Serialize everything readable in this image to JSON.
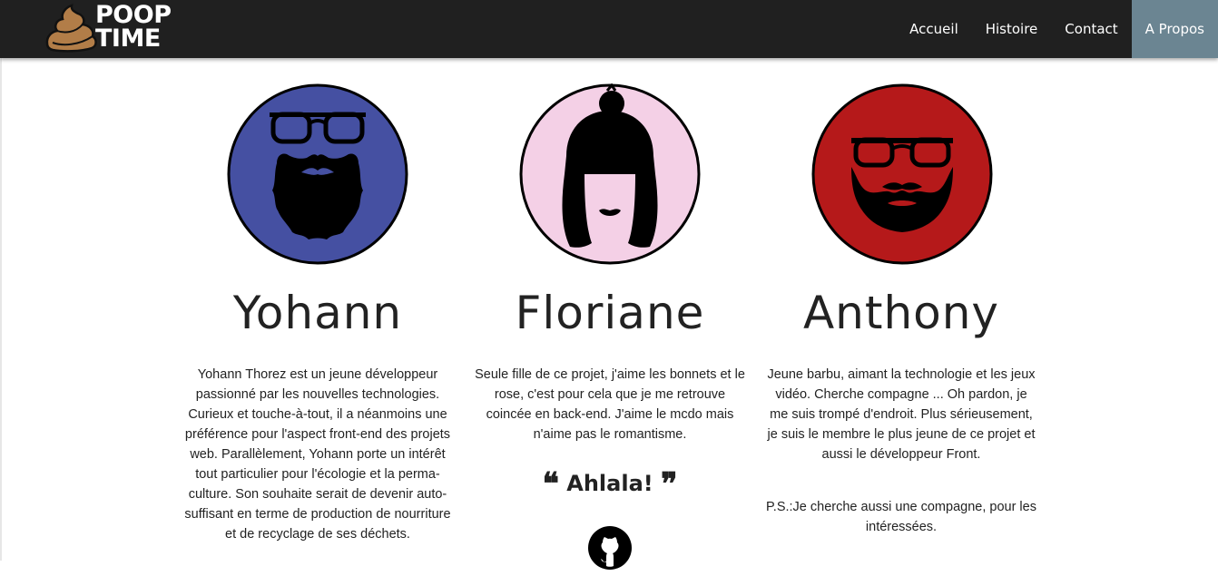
{
  "brand": {
    "line1": "POOP",
    "line2": "TIME",
    "icon": "poop-icon"
  },
  "nav": {
    "items": [
      {
        "label": "Accueil"
      },
      {
        "label": "Histoire"
      },
      {
        "label": "Contact"
      },
      {
        "label": "A Propos",
        "active": true
      }
    ]
  },
  "colors": {
    "navbar": "#202020",
    "nav_active": "#6b8592",
    "avatar_yohann": "#4550a2",
    "avatar_floriane": "#f4d0e6",
    "avatar_anthony": "#b5191a"
  },
  "members": [
    {
      "name": "Yohann",
      "avatar_icon": "bearded-man-glasses-icon",
      "bio": "Yohann Thorez est un jeune développeur passionné par les nouvelles technologies. Curieux et touche-à-tout, il a néanmoins une préférence pour l'aspect front-end des projets web. Parallèlement, Yohann porte un intérêt tout particulier pour l'écologie et la perma-culture. Son souhaite serait de devenir auto-suffisant en terme de production de nourriture et de recyclage de ses déchets."
    },
    {
      "name": "Floriane",
      "avatar_icon": "woman-beanie-icon",
      "bio": "Seule fille de ce projet, j'aime les bonnets et le rose, c'est pour cela que je me retrouve coincée en back-end. J'aime le mcdo mais n'aime pas le romantisme.",
      "quote": "Ahlala!",
      "link_icon": "github-icon"
    },
    {
      "name": "Anthony",
      "avatar_icon": "bearded-man-glasses-icon",
      "bio": "Jeune barbu, aimant la technologie et les jeux vidéo. Cherche compagne ... Oh pardon, je me suis trompé d'endroit. Plus sérieusement, je suis le membre le plus jeune de ce projet et aussi le développeur Front.",
      "ps": "P.S.:Je cherche aussi une compagne, pour les intéressées."
    }
  ]
}
